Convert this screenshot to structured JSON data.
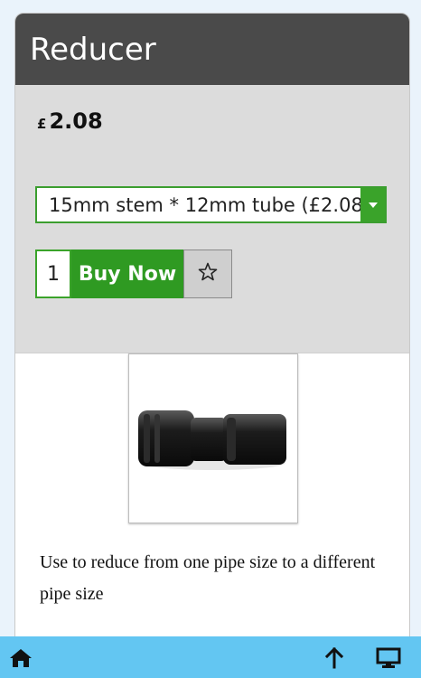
{
  "product": {
    "title": "Reducer",
    "currency_symbol": "£",
    "price": "2.08",
    "option_selected": "15mm stem * 12mm tube (£2.08)",
    "quantity": "1",
    "buy_label": "Buy Now",
    "description": "Use to reduce from one pipe size to a different pipe size"
  },
  "icons": {
    "dropdown": "chevron-down-icon",
    "favourite": "star-icon",
    "home": "home-icon",
    "scroll_top": "arrow-up-icon",
    "desktop": "desktop-icon"
  },
  "colors": {
    "header_bg": "#4a4a4a",
    "accent_green": "#2f9a22",
    "panel_grey": "#dcdcdc",
    "bottom_bar": "#63c6f2"
  }
}
